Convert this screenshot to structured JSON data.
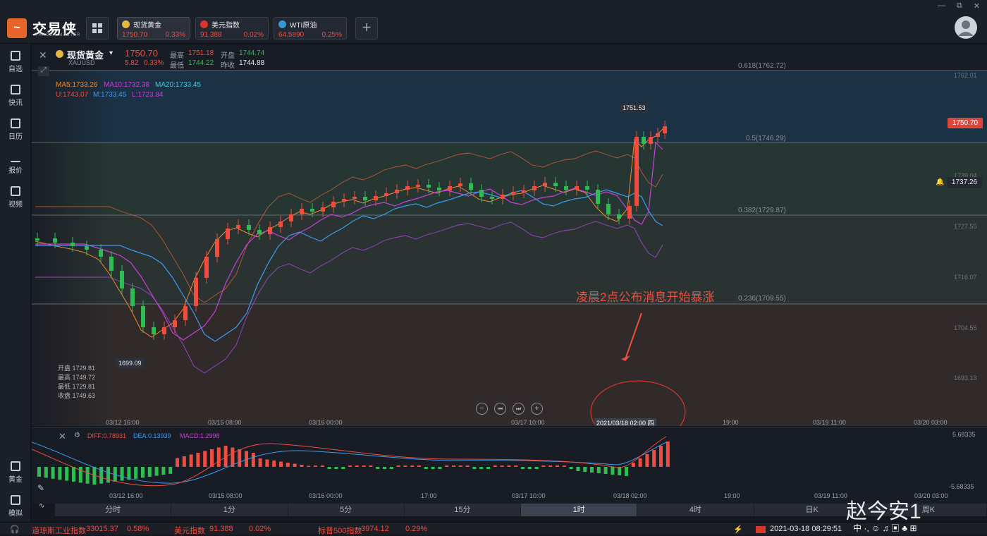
{
  "app": {
    "logo_text": "交易侠",
    "logo_sub": "TRADER MASTER",
    "logo_mark": "~"
  },
  "tabs": [
    {
      "name": "现货黄金",
      "price": "1750.70",
      "change": "0.33%",
      "icon_color": "#e8b63a"
    },
    {
      "name": "美元指数",
      "price": "91.388",
      "change": "0.02%",
      "icon_color": "#d9362b"
    },
    {
      "name": "WTI原油",
      "price": "64.5890",
      "change": "0.25%",
      "icon_color": "#2e9bd6"
    }
  ],
  "add_tab": "+",
  "window_controls": [
    "—",
    "⧉",
    "✕"
  ],
  "sidebar": {
    "top": [
      {
        "label": "自选"
      },
      {
        "label": "快讯"
      },
      {
        "label": "日历"
      },
      {
        "label": "报价"
      },
      {
        "label": "视频"
      }
    ],
    "bottom": [
      {
        "label": "黄金"
      },
      {
        "label": "模拟"
      }
    ]
  },
  "header": {
    "symbol": "现货黄金",
    "code": "XAUUSD",
    "price": "1750.70",
    "chg": "5.82",
    "chg_pct": "0.33%",
    "high_label": "最高",
    "high": "1751.18",
    "open_label": "开盘",
    "open": "1744.74",
    "low_label": "最低",
    "low": "1744.22",
    "prev_label": "昨收",
    "prev": "1744.88"
  },
  "indicators": {
    "ma5": "MA5:1733.26",
    "ma10": "MA10:1732.38",
    "ma20": "MA20:1733.45",
    "u": "U:1743.07",
    "m": "M:1733.45",
    "l": "L:1723.84"
  },
  "ohlc": {
    "open": "开盘 1729.81",
    "high": "最高 1749.72",
    "low": "最低 1729.81",
    "close": "收盘 1749.63"
  },
  "fib": [
    {
      "label": "0.618(1762.72)"
    },
    {
      "label": "0.5(1746.29)"
    },
    {
      "label": "0.382(1729.87)"
    },
    {
      "label": "0.236(1709.55)"
    }
  ],
  "price_axis": [
    "1762.01",
    "1739.04",
    "1727.55",
    "1716.07",
    "1704.55",
    "1693.13"
  ],
  "price_tag": "1750.70",
  "alert_tag": "1737.26",
  "peak_label": "1751.53",
  "trough_label": "1699.09",
  "annotation": "凌晨2点公布消息开始暴涨",
  "time_axis": [
    "03/12 16:00",
    "03/15 08:00",
    "03/16 00:00",
    "03/17 10:00",
    "2021/03/18 02:00 四",
    "19:00",
    "03/19 11:00",
    "03/20 03:00"
  ],
  "macd_axis": [
    "03/12 16:00",
    "03/15 08:00",
    "03/16 00:00",
    "17:00",
    "03/17 10:00",
    "03/18 02:00",
    "19:00",
    "03/19 11:00",
    "03/20 03:00"
  ],
  "macd": {
    "diff": "DIFF:0.78931",
    "dea": "DEA:0.13939",
    "macd": "MACD:1.2998",
    "top": "5.68335",
    "bottom": "-5.68335"
  },
  "zoom_controls": [
    "−",
    "⏮",
    "⏭",
    "+"
  ],
  "periods": [
    {
      "label": "分时"
    },
    {
      "label": "1分"
    },
    {
      "label": "5分"
    },
    {
      "label": "15分"
    },
    {
      "label": "1时",
      "active": true
    },
    {
      "label": "4时"
    },
    {
      "label": "日K"
    },
    {
      "label": "周K"
    }
  ],
  "status": {
    "items": [
      {
        "name": "道琼斯工业指数",
        "value": "33015.37",
        "chg": "0.58%"
      },
      {
        "name": "美元指数",
        "value": "91.388",
        "chg": "0.02%"
      },
      {
        "name": "标普500指数",
        "value": "3974.12",
        "chg": "0.29%"
      }
    ],
    "datetime": "2021-03-18 08:29:51"
  },
  "watermark": "赵今安1",
  "colors": {
    "up": "#ef4d3f",
    "down": "#2fbd53",
    "ma5": "#ef8a2b",
    "ma10": "#c93fd9",
    "ma20": "#3d9bf0"
  }
}
